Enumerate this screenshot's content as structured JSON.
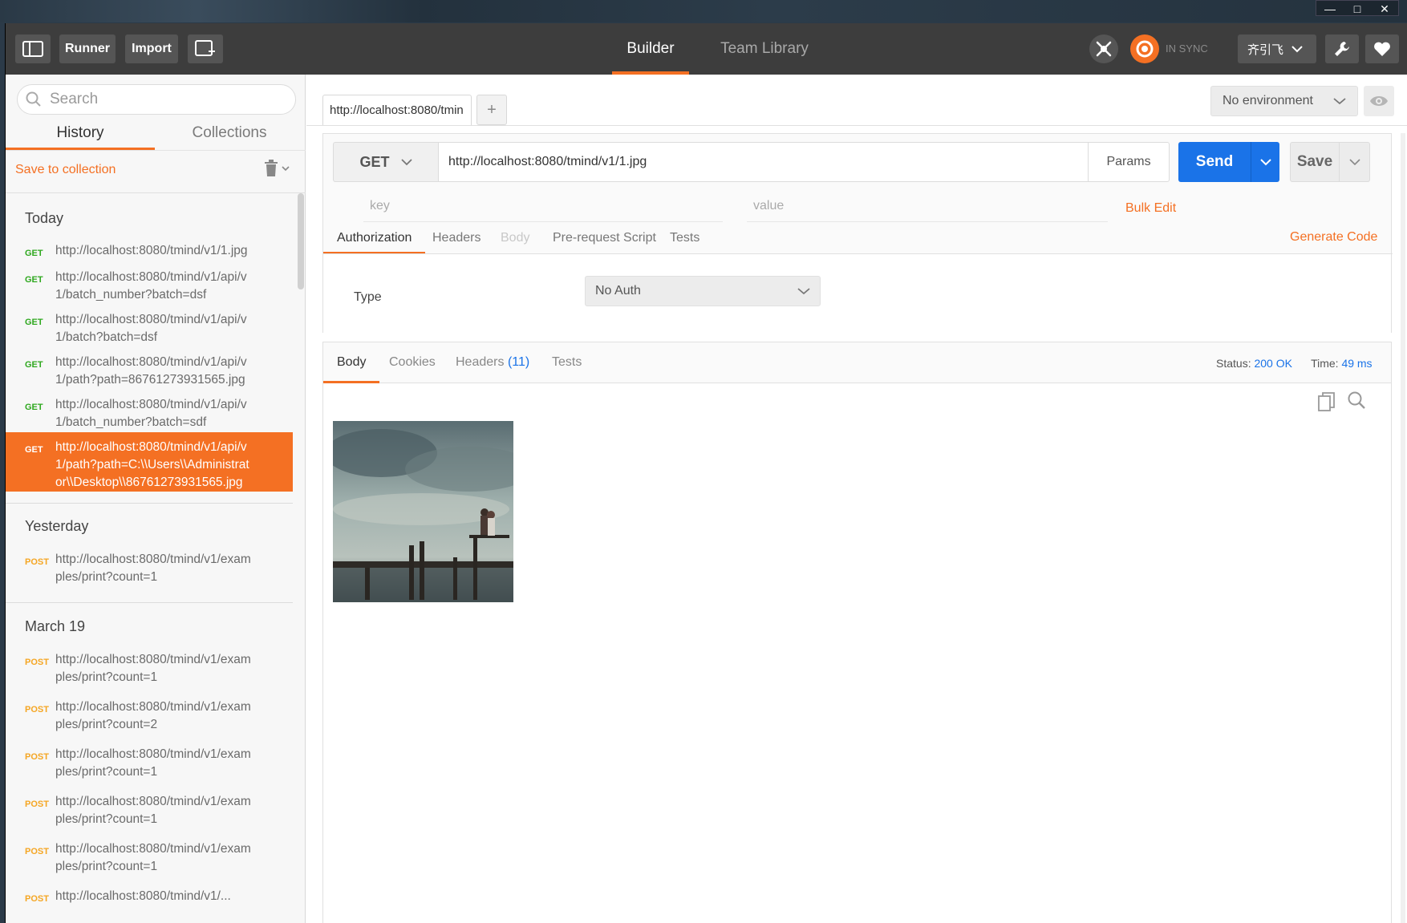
{
  "topbar": {
    "runner_label": "Runner",
    "import_label": "Import",
    "tabs": {
      "builder": "Builder",
      "team_library": "Team Library"
    },
    "sync_status": "IN SYNC",
    "user_name": "齐引飞",
    "accent_color": "#f47023"
  },
  "sidebar": {
    "search_placeholder": "Search",
    "tabs": {
      "history": "History",
      "collections": "Collections"
    },
    "save_to_collection": "Save to collection",
    "groups": {
      "today": "Today",
      "yesterday": "Yesterday",
      "march19": "March 19"
    },
    "history": [
      {
        "method": "GET",
        "url": "http://localhost:8080/tmind/v1/1.jpg"
      },
      {
        "method": "GET",
        "url_line1": "http://localhost:8080/tmind/v1/api/v",
        "url_line2": "1/batch_number?batch=dsf"
      },
      {
        "method": "GET",
        "url_line1": "http://localhost:8080/tmind/v1/api/v",
        "url_line2": "1/batch?batch=dsf"
      },
      {
        "method": "GET",
        "url_line1": "http://localhost:8080/tmind/v1/api/v",
        "url_line2": "1/path?path=86761273931565.jpg"
      },
      {
        "method": "GET",
        "url_line1": "http://localhost:8080/tmind/v1/api/v",
        "url_line2": "1/batch_number?batch=sdf"
      },
      {
        "method": "GET",
        "url_line1": "http://localhost:8080/tmind/v1/api/v",
        "url_line2": "1/path?path=C:\\\\Users\\\\Administrat",
        "url_line3": "or\\\\Desktop\\\\86761273931565.jpg"
      },
      {
        "method": "POST",
        "url_line1": "http://localhost:8080/tmind/v1/exam",
        "url_line2": "ples/print?count=1"
      },
      {
        "method": "POST",
        "url_line1": "http://localhost:8080/tmind/v1/exam",
        "url_line2": "ples/print?count=1"
      },
      {
        "method": "POST",
        "url_line1": "http://localhost:8080/tmind/v1/exam",
        "url_line2": "ples/print?count=2"
      },
      {
        "method": "POST",
        "url_line1": "http://localhost:8080/tmind/v1/exam",
        "url_line2": "ples/print?count=1"
      },
      {
        "method": "POST",
        "url_line1": "http://localhost:8080/tmind/v1/exam",
        "url_line2": "ples/print?count=1"
      },
      {
        "method": "POST",
        "url_line1": "http://localhost:8080/tmind/v1/exam",
        "url_line2": "ples/print?count=1"
      },
      {
        "method": "POST",
        "url": "http://localhost:8080/tmind/v1/..."
      }
    ]
  },
  "request": {
    "tab_title": "http://localhost:8080/tmin",
    "new_tab": "+",
    "environment": "No environment",
    "method": "GET",
    "url": "http://localhost:8080/tmind/v1/1.jpg",
    "params_label": "Params",
    "send_label": "Send",
    "save_label": "Save",
    "key_placeholder": "key",
    "value_placeholder": "value",
    "bulk_edit": "Bulk Edit",
    "tabs": {
      "authorization": "Authorization",
      "headers": "Headers",
      "body": "Body",
      "pre_request": "Pre-request Script",
      "tests": "Tests"
    },
    "generate_code": "Generate Code",
    "auth_type_label": "Type",
    "auth_type_value": "No Auth"
  },
  "response": {
    "tabs": {
      "body": "Body",
      "cookies": "Cookies",
      "headers": "Headers",
      "headers_count": "(11)",
      "tests": "Tests"
    },
    "status_label": "Status:",
    "status_value": "200 OK",
    "time_label": "Time:",
    "time_value": "49 ms"
  }
}
